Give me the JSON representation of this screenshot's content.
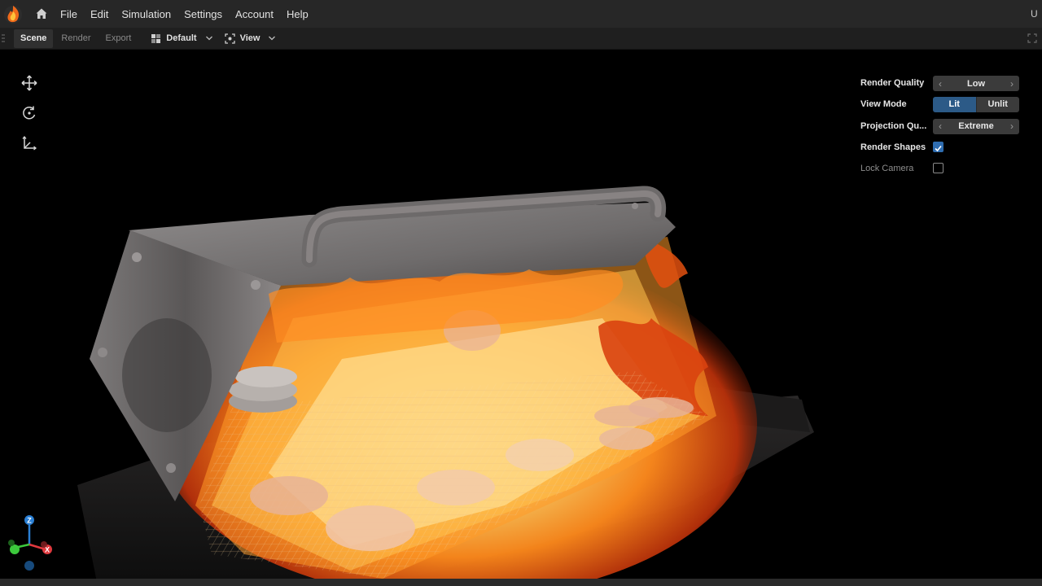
{
  "menubar": {
    "items": [
      {
        "label": "File"
      },
      {
        "label": "Edit"
      },
      {
        "label": "Simulation"
      },
      {
        "label": "Settings"
      },
      {
        "label": "Account"
      },
      {
        "label": "Help"
      }
    ],
    "right_text": "U"
  },
  "toolbar": {
    "tabs": [
      {
        "label": "Scene",
        "active": true
      },
      {
        "label": "Render",
        "active": false
      },
      {
        "label": "Export",
        "active": false
      }
    ],
    "layout_label": "Default",
    "view_label": "View"
  },
  "left_tools": {
    "icons": [
      "move-icon",
      "rotate-icon",
      "axes-scale-icon"
    ]
  },
  "properties": {
    "render_quality": {
      "label": "Render Quality",
      "value": "Low"
    },
    "view_mode": {
      "label": "View Mode",
      "options": [
        "Lit",
        "Unlit"
      ],
      "selected": "Lit"
    },
    "projection_quality": {
      "label": "Projection Qu...",
      "value": "Extreme"
    },
    "render_shapes": {
      "label": "Render Shapes",
      "checked": true
    },
    "lock_camera": {
      "label": "Lock Camera",
      "checked": false
    }
  },
  "gizmo": {
    "axes": [
      "Z",
      "X",
      "Y"
    ],
    "colors": {
      "z": "#2a7fd4",
      "x": "#e0393e",
      "y": "#3cc93c"
    }
  },
  "colors": {
    "menubar_bg": "#272727",
    "toolbar_bg": "#1f1f1f",
    "accent": "#2f6db1",
    "flame_core": "#fff3b0",
    "flame_mid": "#ff9a1e",
    "flame_edge": "#c2340a",
    "hood_metal": "#7d7b7b"
  }
}
